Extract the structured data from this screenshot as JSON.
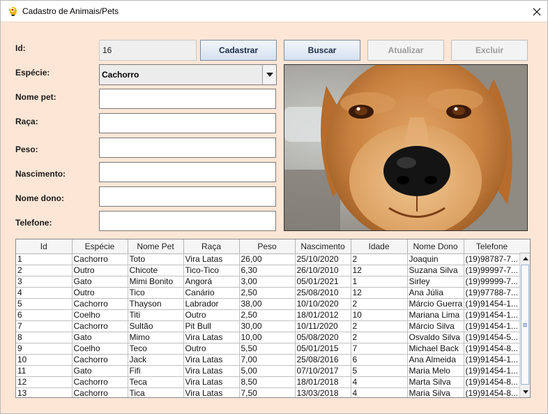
{
  "window": {
    "title": "Cadastro de Animais/Pets"
  },
  "form": {
    "id_label": "Id:",
    "id_value": "16",
    "especie_label": "Espécie:",
    "especie_value": "Cachorro",
    "nome_pet_label": "Nome pet:",
    "raca_label": "Raça:",
    "peso_label": "Peso:",
    "nascimento_label": "Nascimento:",
    "nome_dono_label": "Nome dono:",
    "telefone_label": "Telefone:"
  },
  "buttons": {
    "cadastrar": "Cadastrar",
    "buscar": "Buscar",
    "atualizar": "Atualizar",
    "excluir": "Excluir"
  },
  "photo": {
    "subject": "dog"
  },
  "table": {
    "columns": [
      "Id",
      "Espécie",
      "Nome Pet",
      "Raça",
      "Peso",
      "Nascimento",
      "Idade",
      "Nome Dono",
      "Telefone"
    ],
    "rows": [
      [
        "1",
        "Cachorro",
        "Toto",
        "Vira Latas",
        "26,00",
        "25/10/2020",
        "2",
        "Joaquin",
        "(19)98787-7..."
      ],
      [
        "2",
        "Outro",
        "Chicote",
        "Tico-Tico",
        "6,30",
        "26/10/2010",
        "12",
        "Suzana Silva",
        "(19)99997-7..."
      ],
      [
        "3",
        "Gato",
        "Mimi Bonito",
        "Angorá",
        "3,00",
        "05/01/2021",
        "1",
        "Sirley",
        "(19)99999-7..."
      ],
      [
        "4",
        "Outro",
        "Tico",
        "Canário",
        "2,50",
        "25/08/2010",
        "12",
        "Ana Júlia",
        "(19)97788-7..."
      ],
      [
        "5",
        "Cachorro",
        "Thayson",
        "Labrador",
        "38,00",
        "10/10/2020",
        "2",
        "Márcio Guerra",
        "(19)91454-1..."
      ],
      [
        "6",
        "Coelho",
        "Titi",
        "Outro",
        "2,50",
        "18/01/2012",
        "10",
        "Mariana Lima",
        "(19)91454-1..."
      ],
      [
        "7",
        "Cachorro",
        "Sultão",
        "Pit Bull",
        "30,00",
        "10/11/2020",
        "2",
        "Márcio Silva",
        "(19)91454-1..."
      ],
      [
        "8",
        "Gato",
        "Mimo",
        "Vira Latas",
        "10,00",
        "05/08/2020",
        "2",
        "Osvaldo Silva",
        "(19)91454-5..."
      ],
      [
        "9",
        "Coelho",
        "Teco",
        "Outro",
        "5,50",
        "05/01/2015",
        "7",
        "Michael Back",
        "(19)91454-8..."
      ],
      [
        "10",
        "Cachorro",
        "Jack",
        "Vira Latas",
        "7,00",
        "25/08/2016",
        "6",
        "Ana Almeida",
        "(19)91454-1..."
      ],
      [
        "11",
        "Gato",
        "Fifi",
        "Vira Latas",
        "5,00",
        "07/10/2017",
        "5",
        "Maria Melo",
        "(19)91454-1..."
      ],
      [
        "12",
        "Cachorro",
        "Teca",
        "Vira Latas",
        "8,50",
        "18/01/2018",
        "4",
        "Marta Silva",
        "(19)91454-8..."
      ],
      [
        "13",
        "Cachorro",
        "Tica",
        "Vira Latas",
        "7,50",
        "13/03/2018",
        "4",
        "Maria Silva",
        "(19)91454-8..."
      ]
    ]
  },
  "colors": {
    "background": "#fde6d6",
    "button_gradient_top": "#f2f6fb",
    "button_gradient_bottom": "#d5e1ef"
  }
}
